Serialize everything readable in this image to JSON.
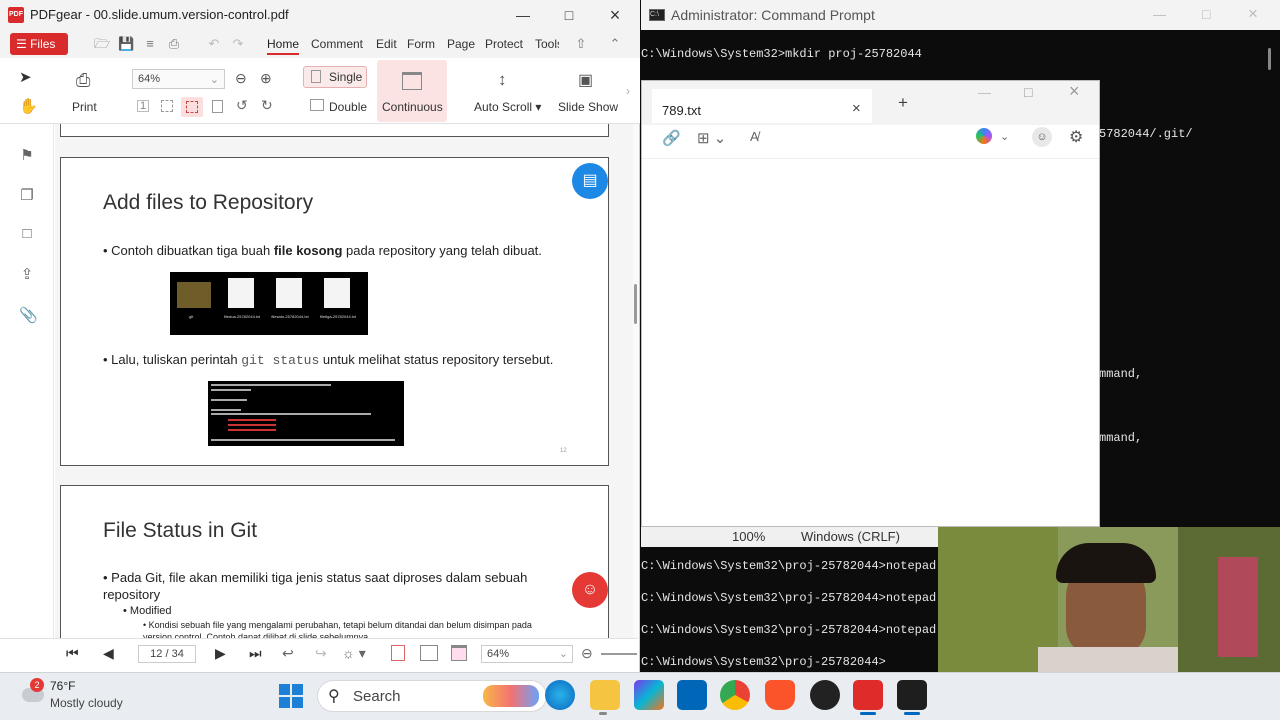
{
  "pdf_window": {
    "title": "PDFgear - 00.slide.umum.version-control.pdf",
    "files_label": "Files",
    "menu": [
      "Home",
      "Comment",
      "Edit",
      "Form",
      "Page",
      "Protect",
      "Tools"
    ],
    "toolbar": {
      "print_label": "Print",
      "zoom_value": "64%",
      "single_label": "Single",
      "double_label": "Double",
      "continuous_label": "Continuous",
      "autoscroll_label": "Auto Scroll",
      "slideshow_label": "Slide Show"
    },
    "slide1": {
      "title": "Add files to Repository",
      "bullet1_pre": "Contoh dibuatkan tiga buah ",
      "bullet1_bold": "file kosong",
      "bullet1_post": " pada repository yang telah dibuat.",
      "bullet2_pre": "Lalu, tuliskan perintah ",
      "bullet2_code": "git status",
      "bullet2_post": " untuk melihat status repository tersebut.",
      "file_labels": [
        ".git",
        "filedua-25782044.txt",
        "filesatu-25782044.txt",
        "filetiga-25782044.txt"
      ],
      "page_number": "12"
    },
    "slide2": {
      "title": "File Status in Git",
      "bullet1": "Pada Git, file akan memiliki tiga jenis status saat diproses dalam sebuah repository",
      "sub1": "Modified",
      "sub2": "Kondisi sebuah file yang mengalami perubahan, tetapi belum ditandai dan belum disimpan pada version control. Contoh dapat dilihat di slide sebelumnya."
    },
    "status": {
      "page_indicator": "12 / 34",
      "zoom_value": "64%"
    }
  },
  "cmd_window": {
    "title": "Administrator: Command Prompt",
    "line1": "C:\\Windows\\System32>mkdir proj-25782044",
    "frag1": "5782044/.git/",
    "frag2": "mmand,",
    "frag3": "mmand,",
    "lines_bottom": [
      "C:\\Windows\\System32\\proj-25782044>notepad",
      "C:\\Windows\\System32\\proj-25782044>notepad",
      "C:\\Windows\\System32\\proj-25782044>notepad",
      "C:\\Windows\\System32\\proj-25782044>"
    ]
  },
  "notepad": {
    "tab_title": "789.txt",
    "status_zoom": "100%",
    "status_eol": "Windows (CRLF)"
  },
  "taskbar": {
    "weather_temp": "76°F",
    "weather_desc": "Mostly cloudy",
    "weather_badge": "2",
    "search_label": "Search"
  }
}
